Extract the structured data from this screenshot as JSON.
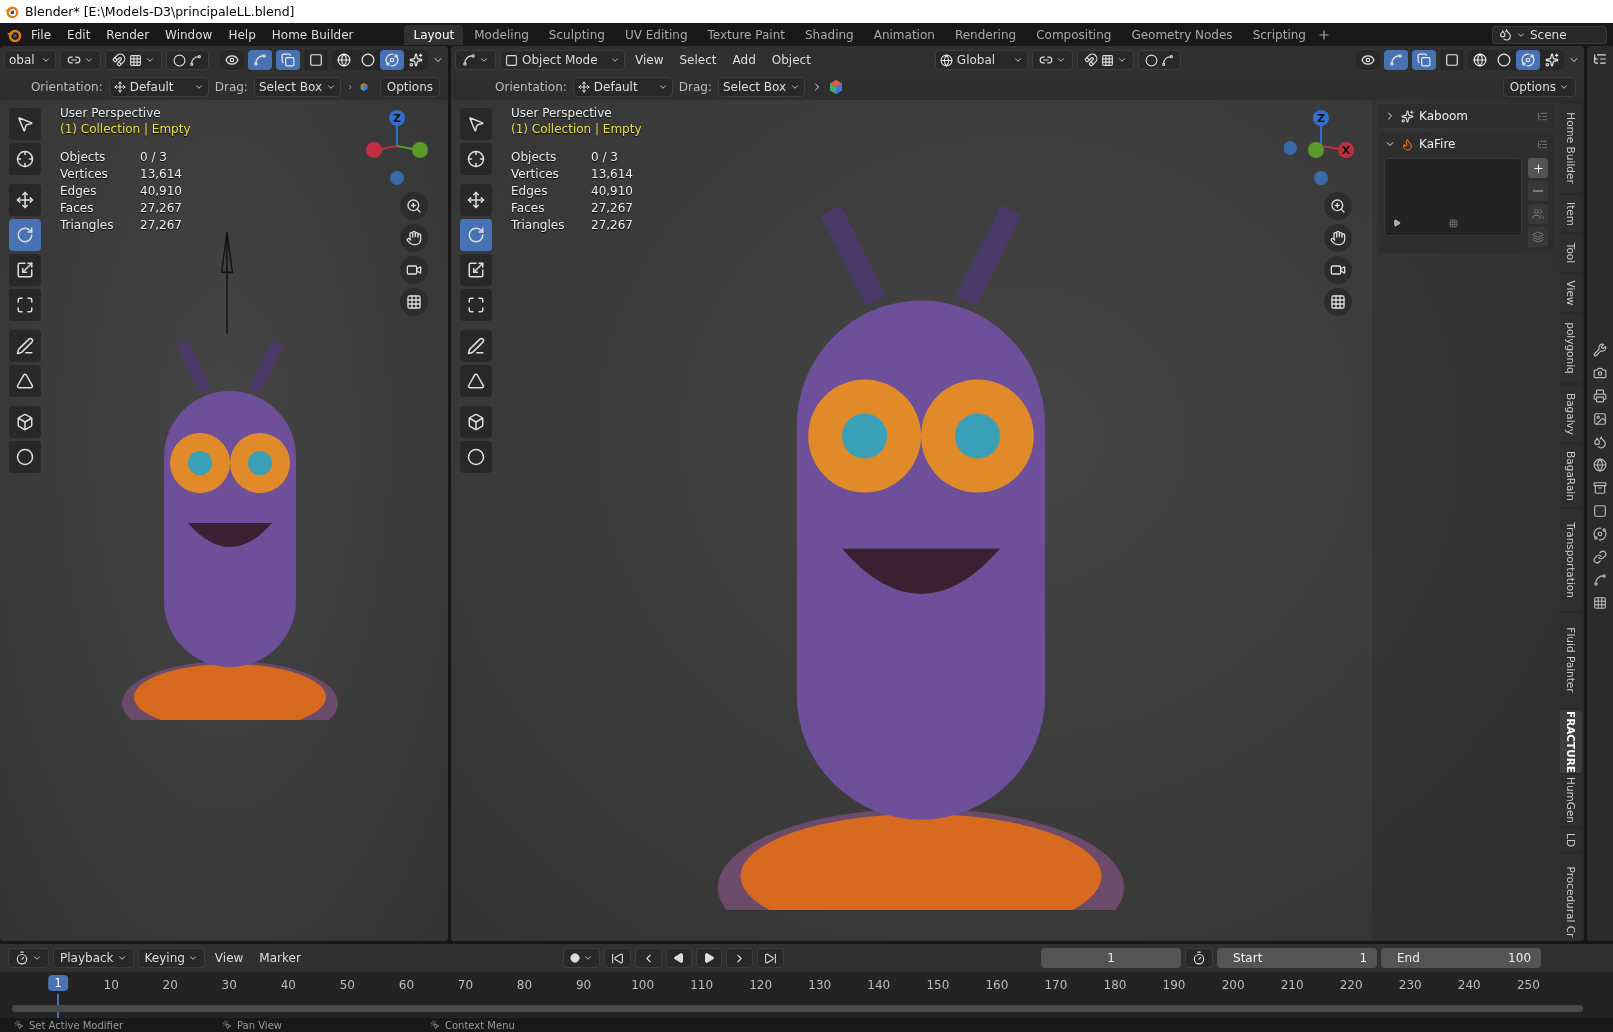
{
  "window": {
    "title": "Blender* [E:\\Models-D3\\principaleLL.blend]"
  },
  "menu": [
    "File",
    "Edit",
    "Render",
    "Window",
    "Help",
    "Home Builder"
  ],
  "workspaces": [
    {
      "label": "Layout",
      "selected": true
    },
    {
      "label": "Modeling",
      "selected": false
    },
    {
      "label": "Sculpting",
      "selected": false
    },
    {
      "label": "UV Editing",
      "selected": false
    },
    {
      "label": "Texture Paint",
      "selected": false
    },
    {
      "label": "Shading",
      "selected": false
    },
    {
      "label": "Animation",
      "selected": false
    },
    {
      "label": "Rendering",
      "selected": false
    },
    {
      "label": "Compositing",
      "selected": false
    },
    {
      "label": "Geometry Nodes",
      "selected": false
    },
    {
      "label": "Scripting",
      "selected": false
    }
  ],
  "scene": "Scene",
  "viewports": [
    {
      "header": {
        "orientation": "obal",
        "toggles": [
          {
            "kind": "selectability",
            "on": false
          },
          {
            "kind": "gizmo",
            "on": true
          },
          {
            "kind": "overlay",
            "on": true
          },
          {
            "kind": "xray",
            "on": false
          }
        ],
        "shading": [
          {
            "kind": "wireframe",
            "selected": false
          },
          {
            "kind": "solid",
            "selected": false
          },
          {
            "kind": "material",
            "selected": true
          },
          {
            "kind": "rendered",
            "selected": false
          }
        ]
      },
      "tool_settings": {
        "orientation_label": "Orientation:",
        "orientation": "Default",
        "drag_label": "Drag:",
        "drag": "Select Box",
        "options": "Options"
      },
      "tools": [
        {
          "kind": "select_box",
          "selected": false
        },
        {
          "kind": "cursor",
          "selected": false
        },
        {
          "kind": "move",
          "selected": false
        },
        {
          "kind": "rotate",
          "selected": true
        },
        {
          "kind": "scale",
          "selected": false
        },
        {
          "kind": "transform",
          "selected": false
        },
        {
          "kind": "annotate",
          "selected": false
        },
        {
          "kind": "measure",
          "selected": false
        },
        {
          "kind": "add_cube",
          "selected": false
        },
        {
          "kind": "sphere",
          "selected": false
        }
      ],
      "perspective": "User Perspective",
      "collection": "(1) Collection | Empty",
      "stats": [
        {
          "label": "Objects",
          "value": "0 / 3"
        },
        {
          "label": "Vertices",
          "value": "13,614"
        },
        {
          "label": "Edges",
          "value": "40,910"
        },
        {
          "label": "Faces",
          "value": "27,267"
        },
        {
          "label": "Triangles",
          "value": "27,267"
        }
      ],
      "gizmo_labels": [
        "Z"
      ]
    },
    {
      "header": {
        "mode": "Object Mode",
        "menus": [
          "View",
          "Select",
          "Add",
          "Object"
        ],
        "orientation": "Global",
        "toggles": [
          {
            "kind": "selectability",
            "on": false
          },
          {
            "kind": "gizmo",
            "on": true
          },
          {
            "kind": "overlay",
            "on": true
          },
          {
            "kind": "xray",
            "on": false
          }
        ],
        "shading": [
          {
            "kind": "wireframe",
            "selected": false
          },
          {
            "kind": "solid",
            "selected": false
          },
          {
            "kind": "material",
            "selected": true
          },
          {
            "kind": "rendered",
            "selected": false
          }
        ]
      },
      "tool_settings": {
        "orientation_label": "Orientation:",
        "orientation": "Default",
        "drag_label": "Drag:",
        "drag": "Select Box",
        "options": "Options"
      },
      "tools": [
        {
          "kind": "select_box",
          "selected": false
        },
        {
          "kind": "cursor",
          "selected": false
        },
        {
          "kind": "move",
          "selected": false
        },
        {
          "kind": "rotate",
          "selected": true
        },
        {
          "kind": "scale",
          "selected": false
        },
        {
          "kind": "transform",
          "selected": false
        },
        {
          "kind": "annotate",
          "selected": false
        },
        {
          "kind": "measure",
          "selected": false
        },
        {
          "kind": "add_cube",
          "selected": false
        },
        {
          "kind": "sphere",
          "selected": false
        }
      ],
      "perspective": "User Perspective",
      "collection": "(1) Collection | Empty",
      "stats": [
        {
          "label": "Objects",
          "value": "0 / 3"
        },
        {
          "label": "Vertices",
          "value": "13,614"
        },
        {
          "label": "Edges",
          "value": "40,910"
        },
        {
          "label": "Faces",
          "value": "27,267"
        },
        {
          "label": "Triangles",
          "value": "27,267"
        }
      ],
      "gizmo_labels": [
        "Z",
        "X"
      ]
    }
  ],
  "sidebar": {
    "panels": [
      {
        "title": "Kaboom",
        "expanded": false
      },
      {
        "title": "KaFire",
        "expanded": true
      }
    ],
    "tabs": [
      {
        "label": "Home Builder",
        "selected": false
      },
      {
        "label": "Item",
        "selected": false
      },
      {
        "label": "Tool",
        "selected": false
      },
      {
        "label": "View",
        "selected": false
      },
      {
        "label": "polygoniq",
        "selected": false
      },
      {
        "label": "Bagalvy",
        "selected": false
      },
      {
        "label": "BagaRain",
        "selected": false
      },
      {
        "label": "Transportation",
        "selected": false
      },
      {
        "label": "Fluid Painter",
        "selected": false
      },
      {
        "label": "FRACTURE",
        "selected": true
      },
      {
        "label": "HumGen",
        "selected": false
      },
      {
        "label": "LD",
        "selected": false
      },
      {
        "label": "Procedural Cr",
        "selected": false
      }
    ]
  },
  "timeline": {
    "menus": [
      {
        "label": "Playback",
        "kind": "dropdown"
      },
      {
        "label": "Keying",
        "kind": "dropdown"
      },
      {
        "label": "View",
        "kind": "plain"
      },
      {
        "label": "Marker",
        "kind": "plain"
      }
    ],
    "current_frame": "1",
    "start_label": "Start",
    "start": "1",
    "end_label": "End",
    "end": "100",
    "playhead": "1",
    "ruler": [
      "10",
      "20",
      "30",
      "40",
      "50",
      "60",
      "70",
      "80",
      "90",
      "100",
      "110",
      "120",
      "130",
      "140",
      "150",
      "160",
      "170",
      "180",
      "190",
      "200",
      "210",
      "220",
      "230",
      "240",
      "250"
    ]
  },
  "status_bar": [
    "Set Active Modifier",
    "Pan View",
    "Context Menu"
  ]
}
